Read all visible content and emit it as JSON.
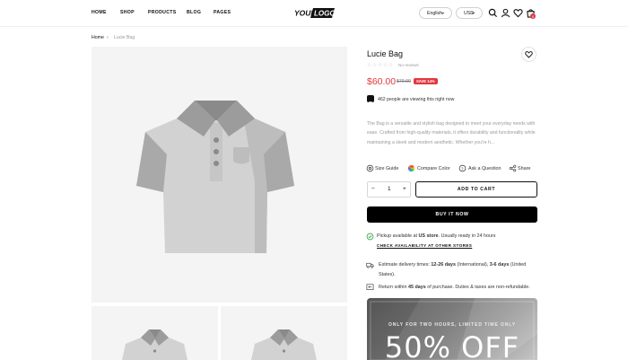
{
  "nav": {
    "items": [
      "HOME",
      "SHOP",
      "PRODUCTS",
      "BLOG",
      "PAGES"
    ]
  },
  "logo": {
    "line1": "YOUR",
    "line2": "LOGO"
  },
  "header": {
    "language": "English",
    "currency": "USD",
    "cart_count": "0"
  },
  "breadcrumb": {
    "home": "Home",
    "separator": "›",
    "current": "Lucie Bag"
  },
  "product": {
    "title": "Lucie Bag",
    "reviews": "No reviews",
    "price": "$60.00",
    "old_price": "$70.00",
    "save": "SAVE 14%",
    "viewers": "462 people are viewing this right now",
    "description": "The Bag is a versatile and stylish bag designed to meet your everyday needs with ease. Crafted from high-quality materials, it offers durability and functionality while maintaining a sleek and modern aesthetic. Whether you're h..."
  },
  "actions": {
    "size_guide": "Size Guide",
    "compare_color": "Compare Color",
    "ask_question": "Ask a Question",
    "share": "Share"
  },
  "cart": {
    "quantity": "1",
    "minus": "−",
    "plus": "+",
    "add_to_cart": "ADD TO CART",
    "buy_now": "BUY IT NOW"
  },
  "pickup": {
    "prefix": "Pickup available at ",
    "store": "US store",
    "suffix": ". Usually ready in 24 hours",
    "check_link": "CHECK AVAILABILITY AT OTHER STORES"
  },
  "delivery": {
    "prefix": "Estimate delivery times: ",
    "intl_days": "12-26 days",
    "intl_label": " (International), ",
    "us_days": "3-6 days",
    "us_label": " (United",
    "us_label2": "States)."
  },
  "returns": {
    "prefix": "Return within ",
    "days": "45 days",
    "suffix": " of purchase. Duties & taxes are non-refundable."
  },
  "promo": {
    "subtitle": "ONLY FOR TWO HOURS, LIMITED TIME ONLY",
    "headline": "50% OFF"
  },
  "colors": {
    "accent": "#e0383e",
    "dark": "#111111",
    "muted": "#9a9a9a"
  }
}
